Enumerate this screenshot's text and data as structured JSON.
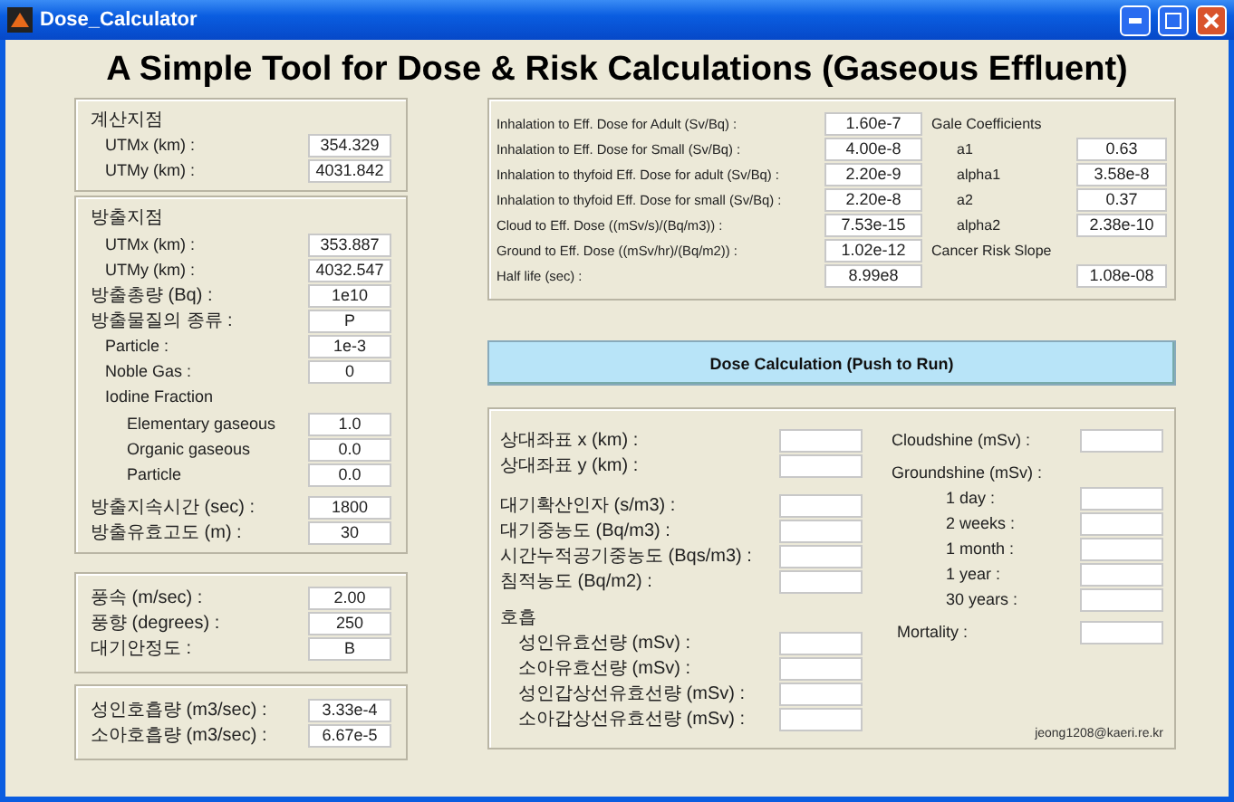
{
  "window": {
    "title": "Dose_Calculator"
  },
  "heading": "A Simple Tool for Dose & Risk Calculations (Gaseous Effluent)",
  "calc_point": {
    "heading": "계산지점",
    "fields": [
      {
        "label": "UTMx (km) :",
        "value": "354.329"
      },
      {
        "label": "UTMy (km) :",
        "value": "4031.842"
      }
    ]
  },
  "release": {
    "heading": "방출지점",
    "fields": [
      {
        "kind": "sub",
        "label": "UTMx (km) :",
        "value": "353.887"
      },
      {
        "kind": "sub",
        "label": "UTMy (km) :",
        "value": "4032.547"
      },
      {
        "kind": "main",
        "label": "방출총량 (Bq) :",
        "value": "1e10"
      },
      {
        "kind": "main",
        "label": "방출물질의 종류 :",
        "value": "P"
      },
      {
        "kind": "sub",
        "label": "Particle :",
        "value": "1e-3"
      },
      {
        "kind": "sub",
        "label": "Noble Gas :",
        "value": "0"
      },
      {
        "kind": "group",
        "label": "Iodine Fraction",
        "children": [
          {
            "label": "Elementary gaseous",
            "value": "1.0"
          },
          {
            "label": "Organic gaseous",
            "value": "0.0"
          },
          {
            "label": "Particle",
            "value": "0.0"
          }
        ]
      }
    ],
    "duration_fields": [
      {
        "label": "방출지속시간 (sec) :",
        "value": "1800"
      },
      {
        "label": "방출유효고도 (m) :",
        "value": "30"
      }
    ]
  },
  "weather": {
    "fields": [
      {
        "label": "풍속 (m/sec) :",
        "value": "2.00"
      },
      {
        "label": "풍향 (degrees) :",
        "value": "250"
      },
      {
        "label": "대기안정도 :",
        "value": "B"
      }
    ]
  },
  "breathing": {
    "fields": [
      {
        "label": "성인호흡량 (m3/sec) :",
        "value": "3.33e-4"
      },
      {
        "label": "소아호흡량 (m3/sec) :",
        "value": "6.67e-5"
      }
    ]
  },
  "coefficients": {
    "fields": [
      {
        "label": "Inhalation to Eff. Dose for Adult (Sv/Bq) :",
        "value": "1.60e-7"
      },
      {
        "label": "Inhalation to Eff. Dose for Small (Sv/Bq) :",
        "value": "4.00e-8"
      },
      {
        "label": "Inhalation to thyfoid Eff. Dose for adult (Sv/Bq) :",
        "value": "2.20e-9"
      },
      {
        "label": "Inhalation to thyfoid Eff. Dose for small (Sv/Bq) :",
        "value": "2.20e-8"
      },
      {
        "label": "Cloud to Eff. Dose ((mSv/s)/(Bq/m3)) :",
        "value": "7.53e-15"
      },
      {
        "label": "Ground to Eff. Dose ((mSv/hr)/(Bq/m2)) :",
        "value": "1.02e-12"
      },
      {
        "label": "Half life (sec) :",
        "value": "8.99e8"
      }
    ],
    "gale": {
      "heading": "Gale Coefficients",
      "fields": [
        {
          "label": "a1",
          "value": "0.63"
        },
        {
          "label": "alpha1",
          "value": "3.58e-8"
        },
        {
          "label": "a2",
          "value": "0.37"
        },
        {
          "label": "alpha2",
          "value": "2.38e-10"
        }
      ]
    },
    "cancer_risk_slope": {
      "label": "Cancer Risk Slope",
      "value": "1.08e-08"
    }
  },
  "run_button": {
    "label": "Dose Calculation (Push to Run)"
  },
  "results": {
    "position_fields": [
      {
        "label": "상대좌표 x (km) :"
      },
      {
        "label": "상대좌표 y (km) :"
      }
    ],
    "concentration_fields": [
      {
        "label": "대기확산인자 (s/m3) :"
      },
      {
        "label": "대기중농도 (Bq/m3) :"
      },
      {
        "label": "시간누적공기중농도 (Bqs/m3) :"
      },
      {
        "label": "침적농도 (Bq/m2) :"
      }
    ],
    "inhalation": {
      "heading": "호흡",
      "fields": [
        {
          "label": "성인유효선량 (mSv) :"
        },
        {
          "label": "소아유효선량 (mSv) :"
        },
        {
          "label": "성인갑상선유효선량 (mSv) :"
        },
        {
          "label": "소아갑상선유효선량 (mSv) :"
        }
      ]
    },
    "cloudshine": {
      "label": "Cloudshine (mSv) :"
    },
    "groundshine": {
      "label": "Groundshine (mSv) :",
      "fields": [
        {
          "label": "1 day :"
        },
        {
          "label": "2 weeks :"
        },
        {
          "label": "1 month :"
        },
        {
          "label": "1 year :"
        },
        {
          "label": "30 years :"
        }
      ]
    },
    "mortality": {
      "label": "Mortality :"
    },
    "email": "jeong1208@kaeri.re.kr"
  }
}
